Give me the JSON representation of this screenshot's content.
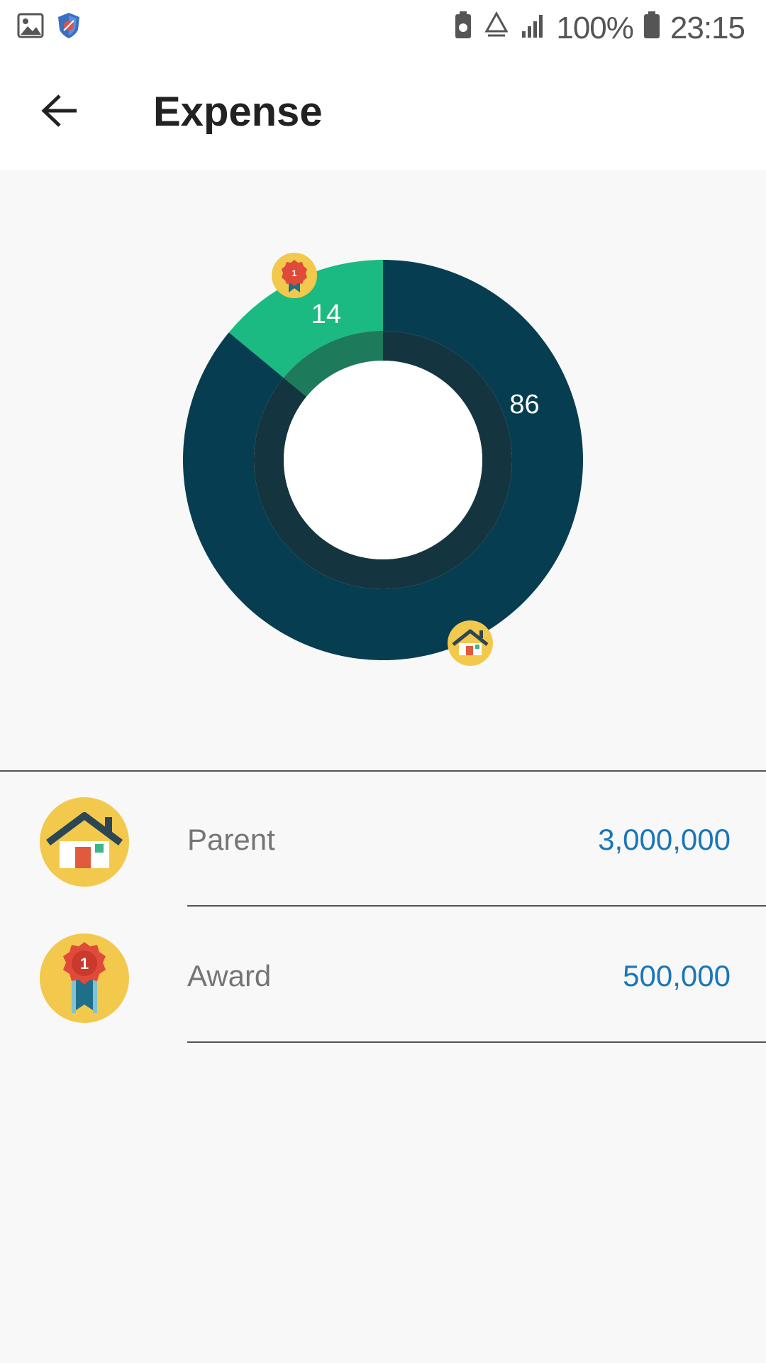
{
  "status_bar": {
    "battery_text": "100%",
    "time": "23:15",
    "icons": [
      "image-icon",
      "shield-icon",
      "battery-saver-icon",
      "recycle-icon",
      "signal-icon",
      "battery-icon"
    ]
  },
  "app_bar": {
    "back_icon": "arrow-back-icon",
    "title": "Expense"
  },
  "chart_data": {
    "type": "pie",
    "style": "donut",
    "labels": [
      "Parent",
      "Award"
    ],
    "values": [
      86,
      14
    ],
    "amounts": [
      "3,000,000",
      "500,000"
    ],
    "colors": [
      "#063d50",
      "#1bba82"
    ],
    "inner_colors": [
      "#143540",
      "#1d7a5a"
    ],
    "slice_icons": [
      "house-icon",
      "medal-icon"
    ],
    "start": "top",
    "direction": "clockwise"
  },
  "list": {
    "items": [
      {
        "icon": "house-icon",
        "label": "Parent",
        "amount": "3,000,000"
      },
      {
        "icon": "medal-icon",
        "label": "Award",
        "amount": "500,000"
      }
    ]
  },
  "colors": {
    "accent": "#1976b8",
    "icon_circle": "#f2c94c"
  }
}
